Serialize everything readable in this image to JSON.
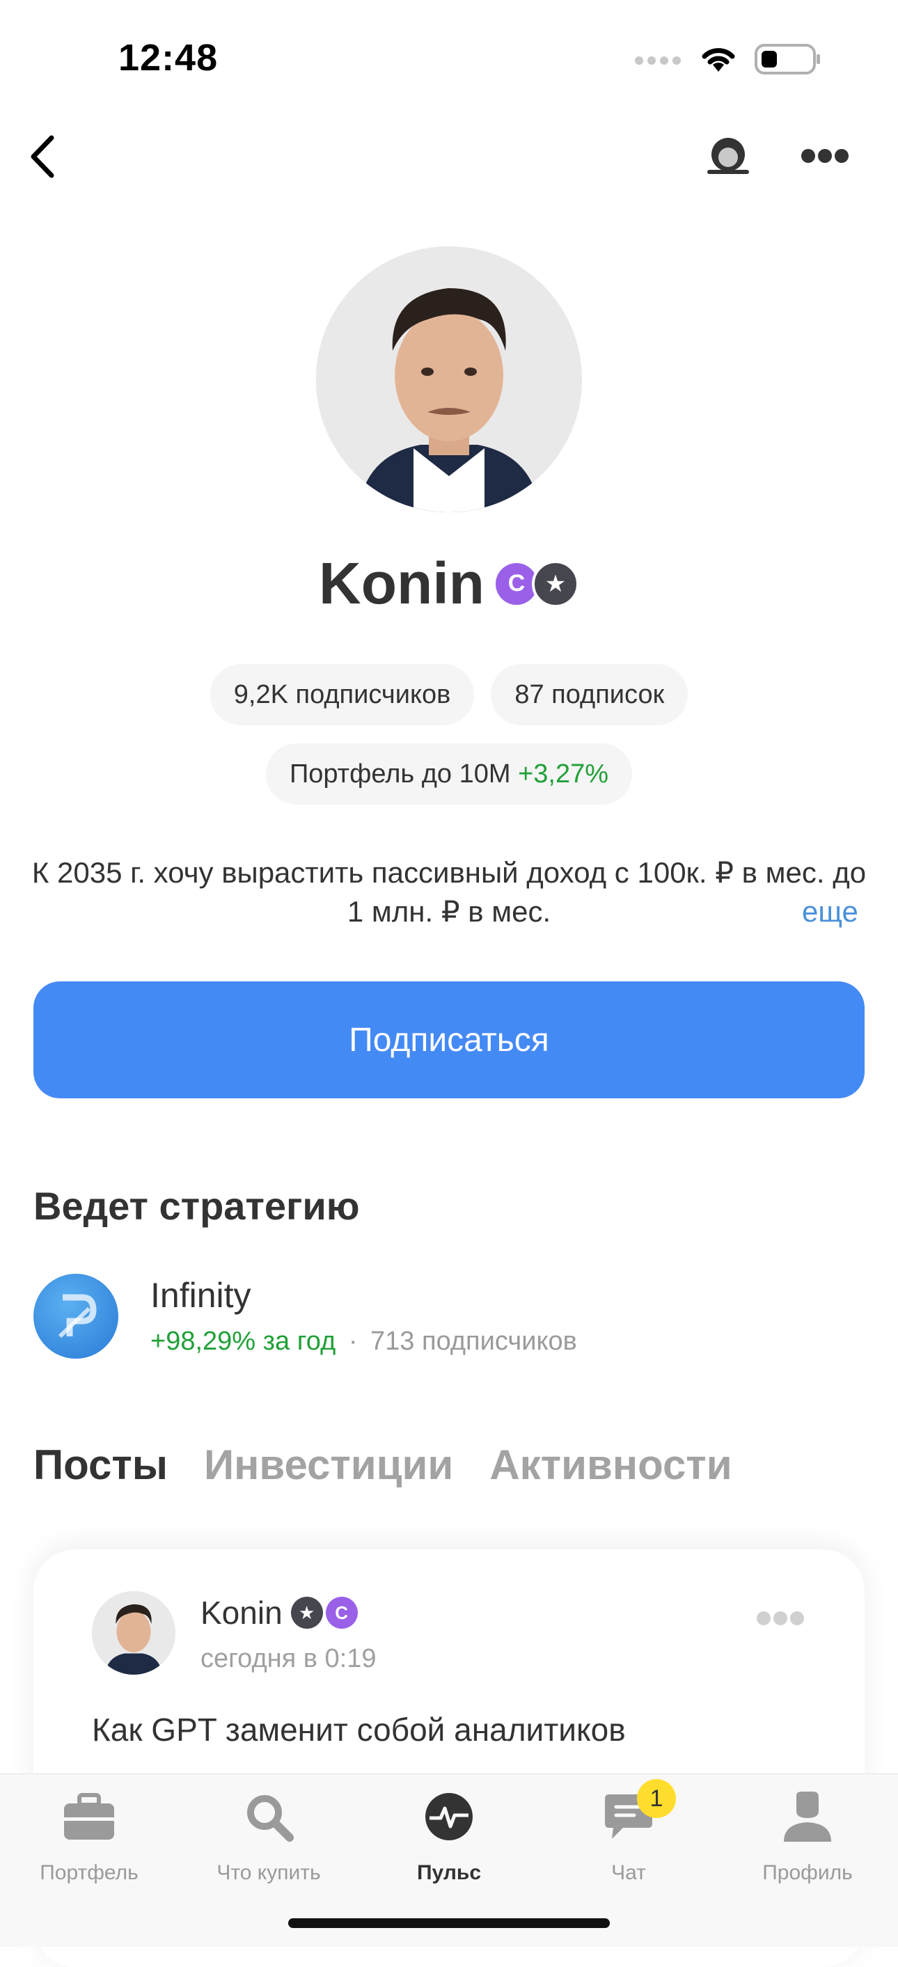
{
  "status_bar": {
    "time": "12:48"
  },
  "profile": {
    "name": "Konin",
    "badge_c_letter": "C",
    "badge_star": "★",
    "subscribers": "9,2K подписчиков",
    "subscriptions": "87 подписок",
    "portfolio_label": "Портфель до 10M",
    "portfolio_change": "+3,27%",
    "bio": "К 2035 г. хочу вырастить пассивный доход с 100к. ₽ в мес. до 1 млн. ₽ в мес.",
    "bio_more": "еще",
    "subscribe_label": "Подписаться"
  },
  "strategy": {
    "section_title": "Ведет стратегию",
    "name": "Infinity",
    "return": "+98,29% за год",
    "separator": "·",
    "subscribers": "713 подписчиков"
  },
  "tabs": [
    {
      "label": "Посты",
      "active": true
    },
    {
      "label": "Инвестиции",
      "active": false
    },
    {
      "label": "Активности",
      "active": false
    }
  ],
  "post": {
    "author": "Konin",
    "time": "сегодня в 0:19",
    "title": "Как GPT заменит собой аналитиков"
  },
  "tabbar": {
    "items": [
      {
        "label": "Портфель",
        "icon": "briefcase-icon",
        "active": false
      },
      {
        "label": "Что купить",
        "icon": "search-icon",
        "active": false
      },
      {
        "label": "Пульс",
        "icon": "pulse-icon",
        "active": true
      },
      {
        "label": "Чат",
        "icon": "chat-icon",
        "active": false,
        "badge": "1"
      },
      {
        "label": "Профиль",
        "icon": "profile-icon",
        "active": false
      }
    ]
  },
  "colors": {
    "accent": "#448af5",
    "positive": "#21a038",
    "badge_yellow": "#ffdd2d"
  }
}
